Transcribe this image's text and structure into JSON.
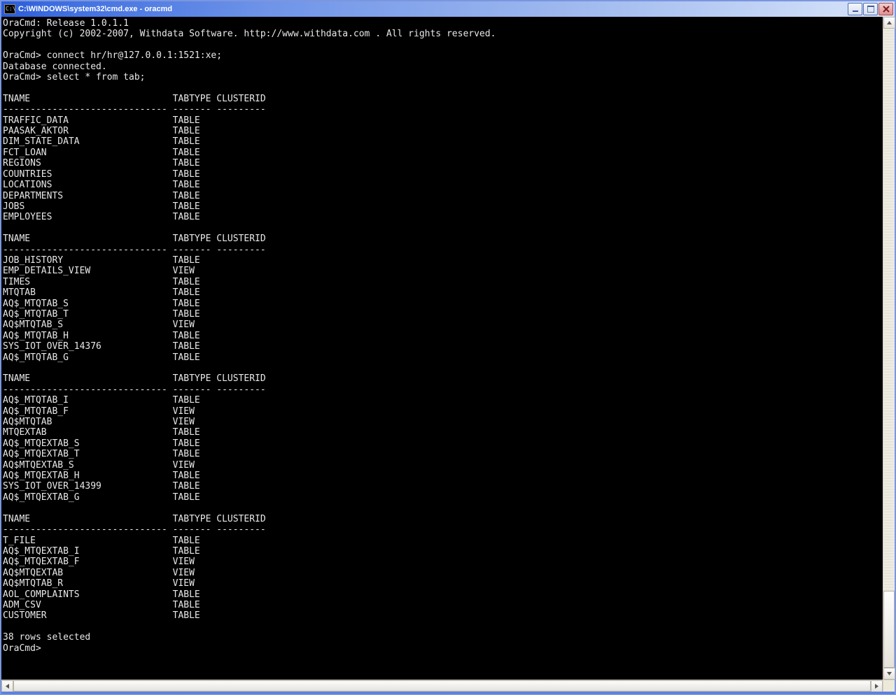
{
  "titlebar": {
    "icon_text": "C:\\",
    "title": "C:\\WINDOWS\\system32\\cmd.exe - oracmd"
  },
  "window_buttons": {
    "minimize": "_",
    "maximize": "❐",
    "close": "✕"
  },
  "terminal": {
    "banner_line1": "OraCmd: Release 1.0.1.1",
    "banner_line2": "Copyright (c) 2002-2007, Withdata Software. http://www.withdata.com . All rights reserved.",
    "prompt": "OraCmd>",
    "cmd_connect": "connect hr/hr@127.0.0.1:1521:xe;",
    "connect_result": "Database connected.",
    "cmd_select": "select * from tab;",
    "columns": {
      "tname": "TNAME",
      "tabtype": "TABTYPE",
      "clusterid": "CLUSTERID"
    },
    "col_widths": {
      "tname": 30,
      "tabtype": 7,
      "clusterid": 9
    },
    "page_size": 10,
    "rows": [
      {
        "tname": "TRAFFIC_DATA",
        "tabtype": "TABLE"
      },
      {
        "tname": "PAASAK_AKTOR",
        "tabtype": "TABLE"
      },
      {
        "tname": "DIM_STATE_DATA",
        "tabtype": "TABLE"
      },
      {
        "tname": "FCT_LOAN",
        "tabtype": "TABLE"
      },
      {
        "tname": "REGIONS",
        "tabtype": "TABLE"
      },
      {
        "tname": "COUNTRIES",
        "tabtype": "TABLE"
      },
      {
        "tname": "LOCATIONS",
        "tabtype": "TABLE"
      },
      {
        "tname": "DEPARTMENTS",
        "tabtype": "TABLE"
      },
      {
        "tname": "JOBS",
        "tabtype": "TABLE"
      },
      {
        "tname": "EMPLOYEES",
        "tabtype": "TABLE"
      },
      {
        "tname": "JOB_HISTORY",
        "tabtype": "TABLE"
      },
      {
        "tname": "EMP_DETAILS_VIEW",
        "tabtype": "VIEW"
      },
      {
        "tname": "TIMES",
        "tabtype": "TABLE"
      },
      {
        "tname": "MTQTAB",
        "tabtype": "TABLE"
      },
      {
        "tname": "AQ$_MTQTAB_S",
        "tabtype": "TABLE"
      },
      {
        "tname": "AQ$_MTQTAB_T",
        "tabtype": "TABLE"
      },
      {
        "tname": "AQ$MTQTAB_S",
        "tabtype": "VIEW"
      },
      {
        "tname": "AQ$_MTQTAB_H",
        "tabtype": "TABLE"
      },
      {
        "tname": "SYS_IOT_OVER_14376",
        "tabtype": "TABLE"
      },
      {
        "tname": "AQ$_MTQTAB_G",
        "tabtype": "TABLE"
      },
      {
        "tname": "AQ$_MTQTAB_I",
        "tabtype": "TABLE"
      },
      {
        "tname": "AQ$_MTQTAB_F",
        "tabtype": "VIEW"
      },
      {
        "tname": "AQ$MTQTAB",
        "tabtype": "VIEW"
      },
      {
        "tname": "MTQEXTAB",
        "tabtype": "TABLE"
      },
      {
        "tname": "AQ$_MTQEXTAB_S",
        "tabtype": "TABLE"
      },
      {
        "tname": "AQ$_MTQEXTAB_T",
        "tabtype": "TABLE"
      },
      {
        "tname": "AQ$MTQEXTAB_S",
        "tabtype": "VIEW"
      },
      {
        "tname": "AQ$_MTQEXTAB_H",
        "tabtype": "TABLE"
      },
      {
        "tname": "SYS_IOT_OVER_14399",
        "tabtype": "TABLE"
      },
      {
        "tname": "AQ$_MTQEXTAB_G",
        "tabtype": "TABLE"
      },
      {
        "tname": "T_FILE",
        "tabtype": "TABLE"
      },
      {
        "tname": "AQ$_MTQEXTAB_I",
        "tabtype": "TABLE"
      },
      {
        "tname": "AQ$_MTQEXTAB_F",
        "tabtype": "VIEW"
      },
      {
        "tname": "AQ$MTQEXTAB",
        "tabtype": "VIEW"
      },
      {
        "tname": "AQ$MTQTAB_R",
        "tabtype": "VIEW"
      },
      {
        "tname": "AOL_COMPLAINTS",
        "tabtype": "TABLE"
      },
      {
        "tname": "ADM_CSV",
        "tabtype": "TABLE"
      },
      {
        "tname": "CUSTOMER",
        "tabtype": "TABLE"
      }
    ],
    "summary": "38 rows selected"
  }
}
